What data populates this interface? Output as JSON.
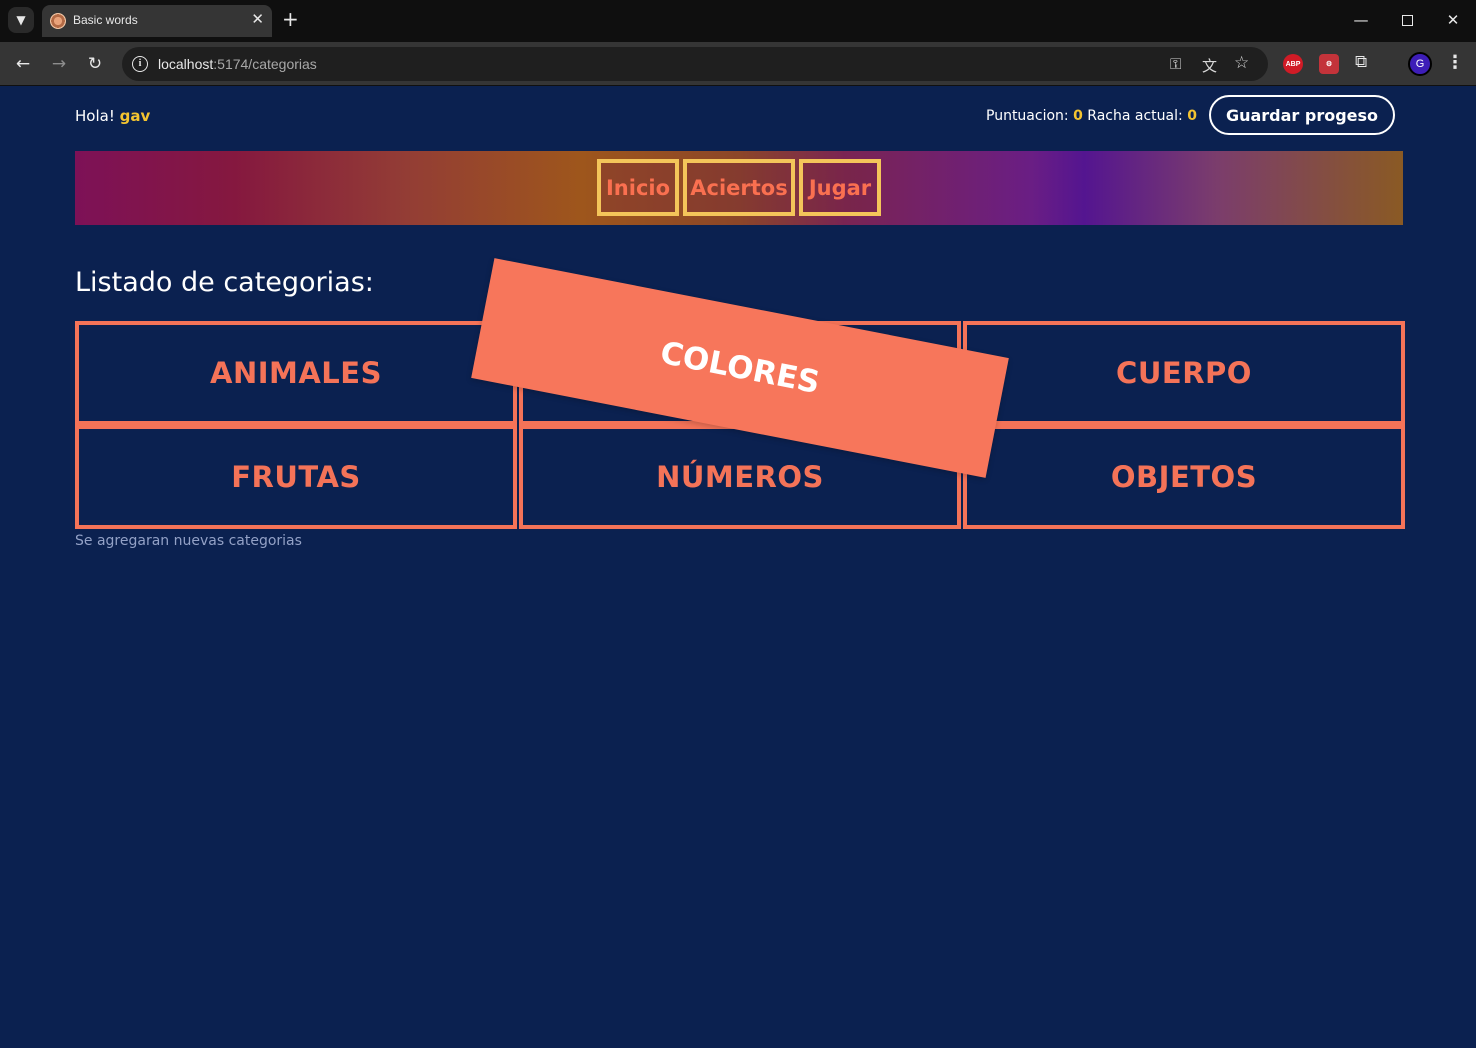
{
  "browser": {
    "tab_title": "Basic words",
    "url_host": "localhost",
    "url_rest": ":5174/categorias"
  },
  "header": {
    "greeting": "Hola!",
    "username": "gav",
    "score_label": "Puntuacion:",
    "score_value": "0",
    "streak_label": "Racha actual:",
    "streak_value": "0",
    "save_label": "Guardar progeso"
  },
  "nav": {
    "links": [
      "Inicio",
      "Aciertos",
      "Jugar"
    ]
  },
  "main": {
    "title": "Listado de categorias:",
    "categories": [
      "ANIMALES",
      "COLORES",
      "CUERPO",
      "FRUTAS",
      "NÚMEROS",
      "OBJETOS"
    ],
    "dragged_category": "COLORES",
    "footnote": "Se agregaran nuevas categorias"
  },
  "colors": {
    "background": "#0b2150",
    "accent": "#f47358",
    "highlight": "#f4c430"
  }
}
